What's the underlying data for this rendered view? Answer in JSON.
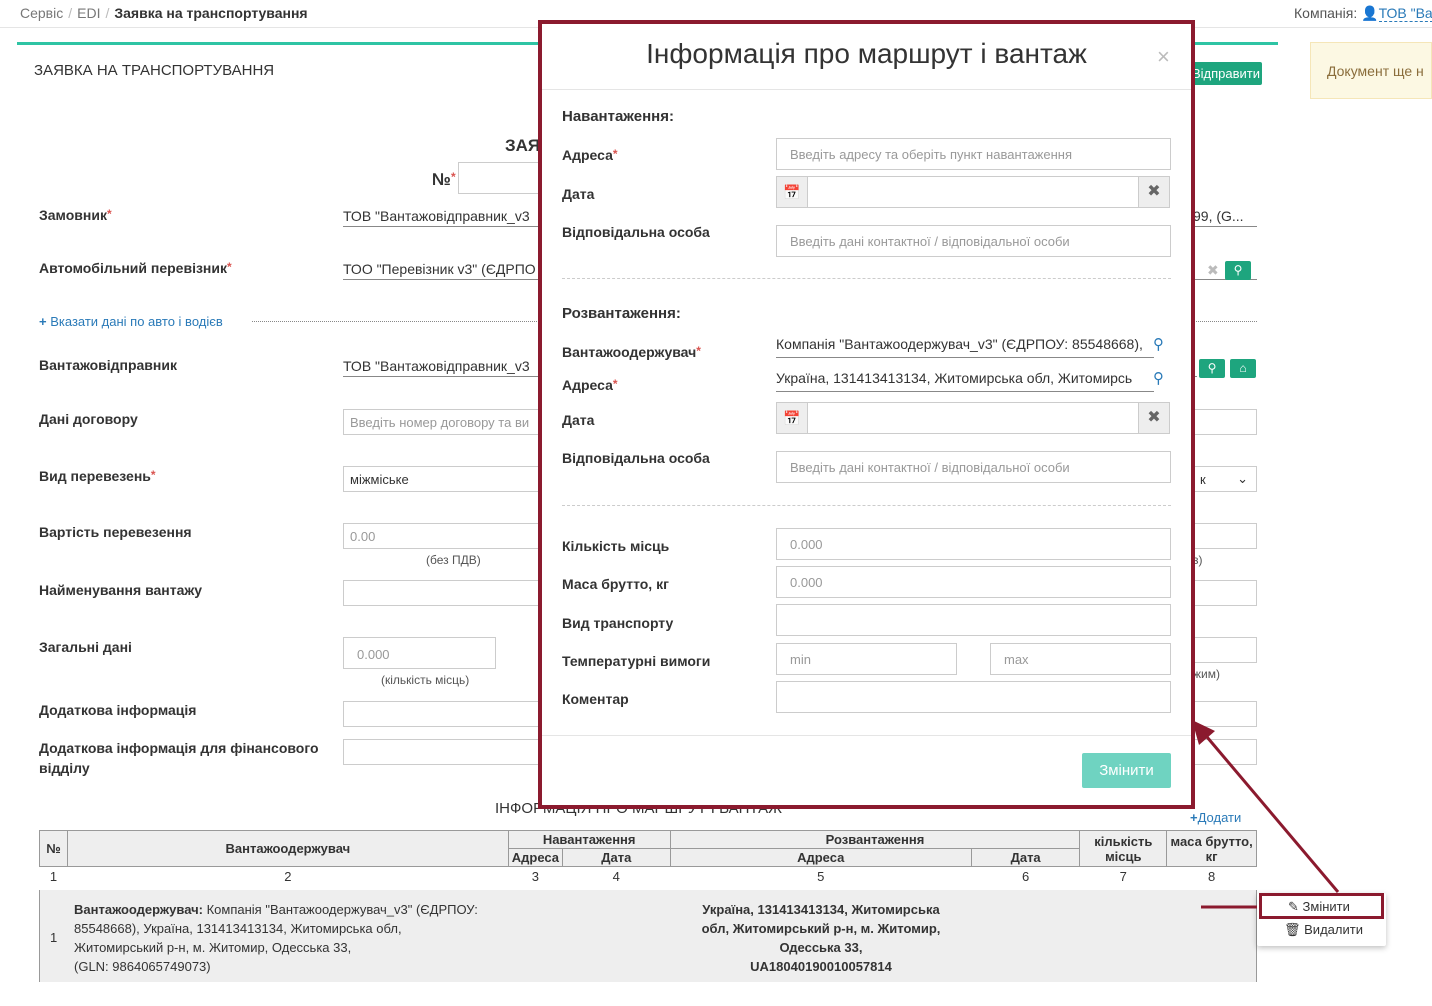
{
  "breadcrumb": {
    "items": [
      "Сервіс",
      "EDI"
    ],
    "current": "Заявка на транспортування"
  },
  "company": {
    "label": "Компанія:",
    "name": "ТОВ \"Ва"
  },
  "page": {
    "title": "ЗАЯВКА НА ТРАНСПОРТУВАННЯ",
    "send_button": "Відправити",
    "notice": "Документ ще н",
    "doc_heading": "ЗАЯ",
    "number_label": "№"
  },
  "form": {
    "customer": {
      "label": "Замовник",
      "value": "ТОВ \"Вантажовідправник_v3",
      "value_right": "99, (G..."
    },
    "carrier": {
      "label": "Автомобільний перевізник",
      "value": "ТОО \"Перевізник v3\" (ЄДРПО"
    },
    "add_vehicle_link": "Вказати дані по авто і водієв",
    "shipper": {
      "label": "Вантажовідправник",
      "value": "ТОВ \"Вантажовідправник_v3"
    },
    "contract": {
      "label": "Дані договору",
      "placeholder": "Введіть номер договору та ви"
    },
    "transport_kind": {
      "label": "Вид перевезень",
      "value": "міжміське",
      "right_value": "к"
    },
    "cost": {
      "label": "Вартість перевезення",
      "value": "0.00",
      "note": "(без ПДВ)",
      "right_note": "з)"
    },
    "cargo_name": {
      "label": "Найменування вантажу"
    },
    "general": {
      "label": "Загальні дані",
      "value": "0.000",
      "note": "(кількість місць)",
      "right_note": "жим)"
    },
    "extra_info": {
      "label": "Додаткова інформація"
    },
    "extra_finance": {
      "label": "Додаткова інформація для фінансового",
      "label2": "відділу"
    }
  },
  "route_table": {
    "title": "ІНФОРМАЦІЯ ПРО МАРШРУТ І ВАНТАЖ",
    "add_link": "Додати",
    "headers": {
      "num": "№",
      "consignee": "Вантажоодержувач",
      "loading": "Навантаження",
      "loading_addr": "Адреса",
      "loading_date": "Дата",
      "unloading": "Розвантаження",
      "unloading_addr": "Адреса",
      "unloading_date": "Дата",
      "places": "кількість місць",
      "mass": "маса брутто, кг"
    },
    "col_numbers": [
      "1",
      "2",
      "3",
      "4",
      "5",
      "6",
      "7",
      "8"
    ],
    "row": {
      "num": "1",
      "consignee_label": "Вантажоодержувач:",
      "consignee_lines": [
        " Компанія \"Вантажоодержувач_v3\" (ЄДРПОУ:",
        "85548668), Україна, 131413413134, Житомирська обл,",
        "Житомирський р-н, м. Житомир, Одесська 33,",
        "(GLN: 9864065749073)"
      ],
      "unloading_lines": [
        "Україна, 131413413134, Житомирська",
        "обл, Житомирський р-н, м. Житомир,",
        "Одесська 33,",
        "UA18040190010057814"
      ]
    }
  },
  "context_menu": {
    "edit": "Змінити",
    "delete": "Видалити"
  },
  "modal": {
    "title": "Інформація про маршрут і вантаж",
    "close": "×",
    "loading_section": "Навантаження:",
    "address_label": "Адреса",
    "address_placeholder": "Введіть адресу та оберіть пункт навантаження",
    "date_label": "Дата",
    "contact_label": "Відповідальна особа",
    "contact_placeholder": "Введіть дані контактної / відповідальної особи",
    "unloading_section": "Розвантаження:",
    "consignee_label": "Вантажоодержувач",
    "consignee_value": "Компанія \"Вантажоодержувач_v3\" (ЄДРПОУ: 85548668),",
    "unload_address_value": "Україна, 131413413134, Житомирська обл, Житомирсь",
    "places_label": "Кількість місць",
    "places_placeholder": "0.000",
    "mass_label": "Маса брутто, кг",
    "mass_placeholder": "0.000",
    "transport_label": "Вид транспорту",
    "temp_label": "Температурні вимоги",
    "temp_min": "min",
    "temp_max": "max",
    "comment_label": "Коментар",
    "save_button": "Змінити"
  },
  "colors": {
    "accent": "#1ea57e",
    "highlight": "#8b1a2e",
    "link": "#2a7ab8"
  }
}
